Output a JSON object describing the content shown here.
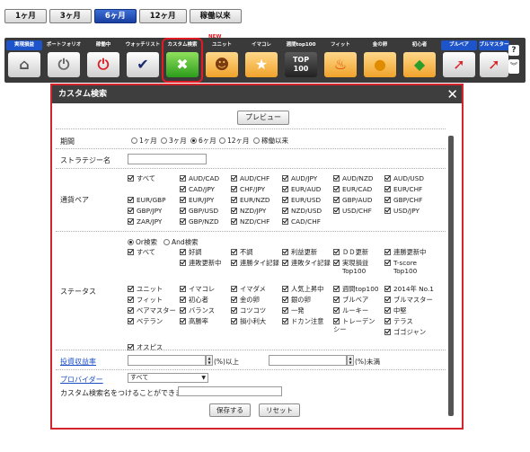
{
  "period_tabs": [
    "1ヶ月",
    "3ヶ月",
    "6ヶ月",
    "12ヶ月",
    "稼働以来"
  ],
  "active_period": "6ヶ月",
  "toolbar": {
    "new_badge": "NEW",
    "items": [
      {
        "label": "実現損益",
        "icon": "home-icon"
      },
      {
        "label": "ポートフォリオ",
        "icon": "power-gray-icon"
      },
      {
        "label": "稼働中",
        "icon": "power-red-icon"
      },
      {
        "label": "ウォッチリスト",
        "icon": "check-icon"
      },
      {
        "label": "カスタム検索",
        "icon": "tools-icon"
      },
      {
        "label": "ユニット",
        "icon": "unit-icon"
      },
      {
        "label": "イマコレ",
        "icon": "star-icon"
      },
      {
        "label": "週間top100",
        "icon": "top100-icon",
        "icon_text": "TOP 100"
      },
      {
        "label": "フィット",
        "icon": "flame-icon"
      },
      {
        "label": "金の卵",
        "icon": "golden-egg-icon"
      },
      {
        "label": "初心者",
        "icon": "beginner-icon"
      },
      {
        "label": "ブルベア",
        "icon": "bull-bear-icon"
      },
      {
        "label": "ブルマスター",
        "icon": "bull-master-icon"
      }
    ],
    "help_label": "?",
    "collapse_label": "︾"
  },
  "modal": {
    "title": "カスタム検索",
    "preview_label": "プレビュー",
    "period": {
      "label": "期間",
      "options": [
        "1ヶ月",
        "3ヶ月",
        "6ヶ月",
        "12ヶ月",
        "稼働以来"
      ],
      "selected": "6ヶ月"
    },
    "strategy_name": {
      "label": "ストラテジー名",
      "value": ""
    },
    "currency_pair": {
      "label": "通貨ペア",
      "items": [
        {
          "label": "すべて",
          "checked": true
        },
        {
          "label": "AUD/CAD",
          "checked": true
        },
        {
          "label": "AUD/CHF",
          "checked": true
        },
        {
          "label": "AUD/JPY",
          "checked": true
        },
        {
          "label": "AUD/NZD",
          "checked": true
        },
        {
          "label": "AUD/USD",
          "checked": true
        },
        {
          "label": "CAD/JPY",
          "checked": true
        },
        {
          "label": "CHF/JPY",
          "checked": true
        },
        {
          "label": "EUR/AUD",
          "checked": true
        },
        {
          "label": "EUR/CAD",
          "checked": true
        },
        {
          "label": "EUR/CHF",
          "checked": true
        },
        {
          "label": "EUR/GBP",
          "checked": true
        },
        {
          "label": "EUR/JPY",
          "checked": true
        },
        {
          "label": "EUR/NZD",
          "checked": true
        },
        {
          "label": "EUR/USD",
          "checked": true
        },
        {
          "label": "GBP/AUD",
          "checked": true
        },
        {
          "label": "GBP/CHF",
          "checked": true
        },
        {
          "label": "GBP/JPY",
          "checked": true
        },
        {
          "label": "GBP/USD",
          "checked": true
        },
        {
          "label": "NZD/JPY",
          "checked": true
        },
        {
          "label": "NZD/USD",
          "checked": true
        },
        {
          "label": "USD/CHF",
          "checked": true
        },
        {
          "label": "USD/JPY",
          "checked": true
        },
        {
          "label": "ZAR/JPY",
          "checked": true
        },
        {
          "label": "GBP/NZD",
          "checked": true
        },
        {
          "label": "NZD/CHF",
          "checked": true
        },
        {
          "label": "CAD/CHF",
          "checked": true
        }
      ]
    },
    "status": {
      "label": "ステータス",
      "search_modes": [
        "Or検索",
        "And検索"
      ],
      "search_mode_selected": "Or検索",
      "items": [
        {
          "label": "すべて",
          "checked": true
        },
        {
          "label": "好調",
          "checked": true
        },
        {
          "label": "不調",
          "checked": true
        },
        {
          "label": "利益更新",
          "checked": true
        },
        {
          "label": "ＤＤ更新",
          "checked": true
        },
        {
          "label": "連勝更新中",
          "checked": true
        },
        {
          "label": "連敗更新中",
          "checked": true
        },
        {
          "label": "連勝タイ記録",
          "checked": true
        },
        {
          "label": "連敗タイ記録",
          "checked": true
        },
        {
          "label": "実現損益",
          "sub": "Top100",
          "checked": true
        },
        {
          "label": "T-score",
          "sub": "Top100",
          "checked": true
        },
        {
          "label": "ユニット",
          "checked": true
        },
        {
          "label": "イマコレ",
          "checked": true
        },
        {
          "label": "イマダメ",
          "checked": true
        },
        {
          "label": "人気上昇中",
          "checked": true
        },
        {
          "label": "週間top100",
          "checked": true
        },
        {
          "label": "2014年 No.1",
          "checked": true
        },
        {
          "label": "フィット",
          "checked": true
        },
        {
          "label": "初心者",
          "checked": true
        },
        {
          "label": "金の卵",
          "checked": true
        },
        {
          "label": "銀の卵",
          "checked": true
        },
        {
          "label": "ブルベア",
          "checked": true
        },
        {
          "label": "ブルマスター",
          "checked": true
        },
        {
          "label": "ベアマスター",
          "checked": true
        },
        {
          "label": "バランス",
          "checked": true
        },
        {
          "label": "コツコツ",
          "checked": true
        },
        {
          "label": "一発",
          "checked": true
        },
        {
          "label": "ルーキー",
          "checked": true
        },
        {
          "label": "中堅",
          "checked": true
        },
        {
          "label": "ベテラン",
          "checked": true
        },
        {
          "label": "高勝率",
          "checked": true
        },
        {
          "label": "損小利大",
          "checked": true
        },
        {
          "label": "ドカン注意",
          "checked": true
        },
        {
          "label": "トレーデンシー",
          "checked": true
        },
        {
          "label": "テラス",
          "checked": true
        },
        {
          "label": "ゴゴジャン",
          "checked": true
        },
        {
          "label": "オスピス",
          "checked": true
        }
      ]
    },
    "roi": {
      "label": "投資収益率",
      "min_value": "",
      "min_unit": "(%)以上",
      "max_value": "",
      "max_unit": "(%)未満"
    },
    "provider": {
      "label": "プロバイダー",
      "selected": "すべて"
    },
    "custom_name": {
      "label": "カスタム検索名をつけることができます",
      "value": ""
    },
    "save_label": "保存する",
    "reset_label": "リセット"
  }
}
